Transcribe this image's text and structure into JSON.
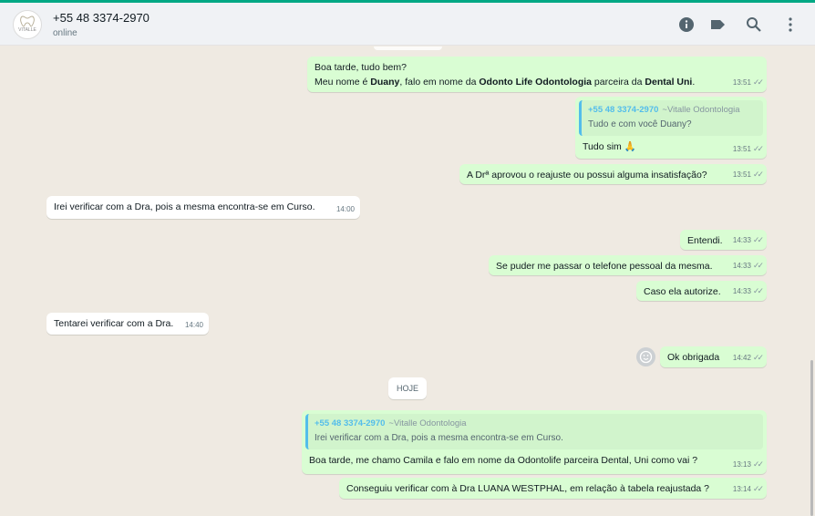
{
  "header": {
    "avatar_logo_text": "VITALLE",
    "contact_name": "+55 48 3374-2970",
    "status": "online",
    "icons": [
      "info-icon",
      "label-icon",
      "search-icon",
      "menu-icon"
    ]
  },
  "colors": {
    "accent": "#00a884",
    "outgoing_bubble": "#d9fdd3",
    "incoming_bubble": "#ffffff",
    "chat_bg": "#efeae2",
    "quote_name": "#53bdeb"
  },
  "messages": {
    "m1": {
      "line1": "Boa tarde, tudo bem?",
      "line2_a": "Meu nome é ",
      "line2_b": "Duany",
      "line2_c": ", falo em nome da ",
      "line2_d": "Odonto Life Odontologia",
      "line2_e": " parceira da ",
      "line2_f": "Dental Uni",
      "line2_g": ".",
      "time": "13:51"
    },
    "m2": {
      "quote_name": "+55 48 3374-2970",
      "quote_sub": "~Vitalle Odontologia",
      "quote_text": "Tudo e com você Duany?",
      "text": "Tudo sim",
      "emoji": "🙏",
      "time": "13:51"
    },
    "m3": {
      "text": "A Drª aprovou o reajuste ou possui alguma insatisfação?",
      "time": "13:51"
    },
    "m4": {
      "text": "Irei verificar com a Dra, pois a mesma encontra-se em Curso.",
      "time": "14:00"
    },
    "m5": {
      "text": "Entendi.",
      "time": "14:33"
    },
    "m6": {
      "text": "Se puder me passar o telefone pessoal da mesma.",
      "time": "14:33"
    },
    "m7": {
      "text": "Caso ela autorize.",
      "time": "14:33"
    },
    "m8": {
      "text": "Tentarei verificar com a Dra.",
      "time": "14:40"
    },
    "m9": {
      "text": "Ok obrigada",
      "time": "14:42"
    },
    "date_divider": "HOJE",
    "m10": {
      "quote_name": "+55 48 3374-2970",
      "quote_sub": "~Vitalle Odontologia",
      "quote_text": "Irei verificar com a Dra, pois a mesma encontra-se em Curso.",
      "text": "Boa tarde, me chamo Camila e falo em nome da Odontolife parceira Dental, Uni como vai ?",
      "time": "13:13"
    },
    "m11": {
      "text": "Conseguiu verificar com à Dra LUANA WESTPHAL, em relação à tabela reajustada ?",
      "time": "13:14"
    }
  },
  "ticks": "✓✓"
}
